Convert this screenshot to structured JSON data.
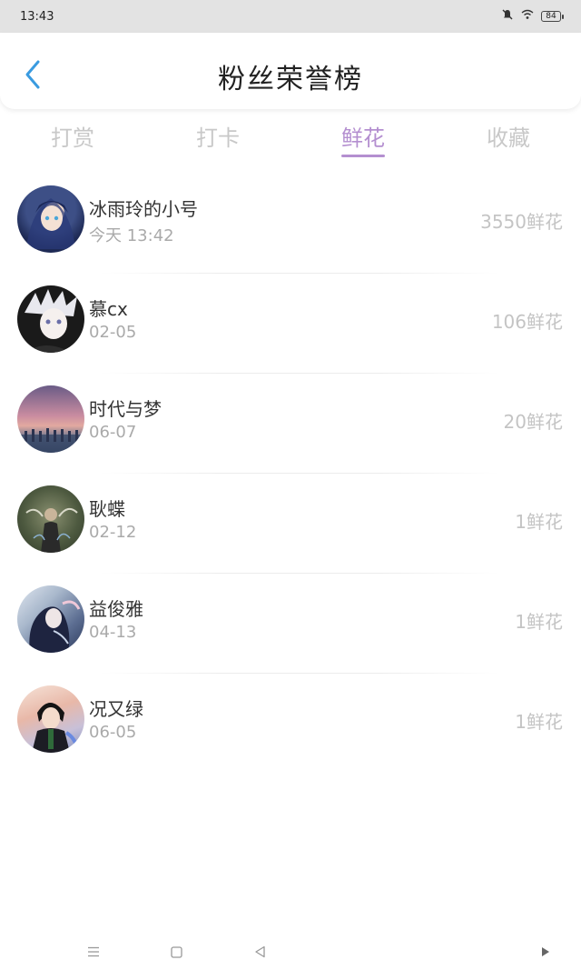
{
  "status_bar": {
    "time": "13:43",
    "battery": "84",
    "icons": [
      "mute-icon",
      "wifi-icon",
      "battery-icon"
    ]
  },
  "header": {
    "title": "粉丝荣誉榜",
    "back_icon": "chevron-left-icon",
    "accent_color": "#3a9be0"
  },
  "tabs": [
    {
      "label": "打赏",
      "active": false
    },
    {
      "label": "打卡",
      "active": false
    },
    {
      "label": "鲜花",
      "active": true
    },
    {
      "label": "收藏",
      "active": false
    }
  ],
  "tab_active_color": "#b48fd0",
  "fans": [
    {
      "name": "冰雨玲的小号",
      "date": "今天 13:42",
      "amount": "3550鲜花"
    },
    {
      "name": "慕cx",
      "date": "02-05",
      "amount": "106鲜花"
    },
    {
      "name": "时代与梦",
      "date": "06-07",
      "amount": "20鲜花"
    },
    {
      "name": "耿蝶",
      "date": "02-12",
      "amount": "1鲜花"
    },
    {
      "name": "益俊雅",
      "date": "04-13",
      "amount": "1鲜花"
    },
    {
      "name": "况又绿",
      "date": "06-05",
      "amount": "1鲜花"
    }
  ],
  "nav_bar": {
    "icons": [
      "menu-icon",
      "home-square-icon",
      "back-triangle-icon",
      "play-icon"
    ]
  }
}
